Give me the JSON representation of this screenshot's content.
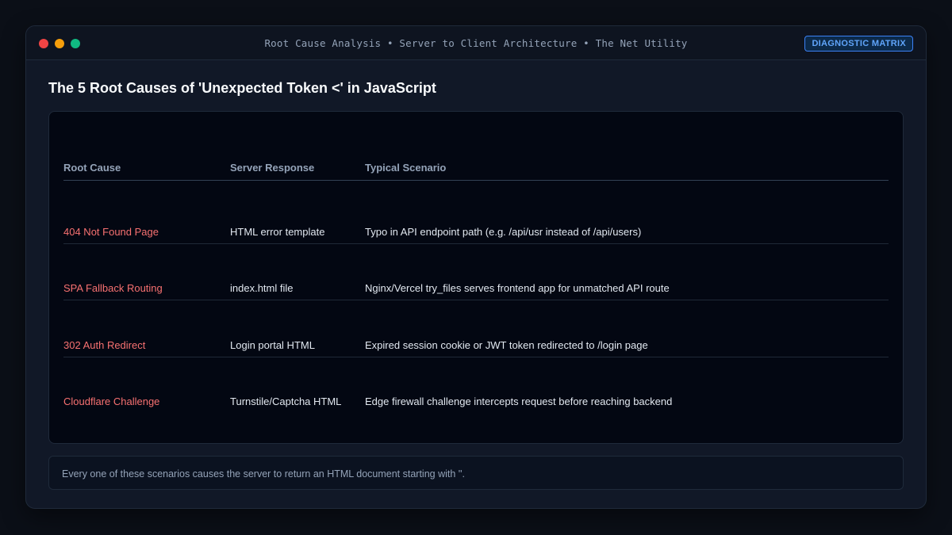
{
  "window": {
    "title": "Root Cause Analysis • Server to Client Architecture • The Net Utility",
    "badge": "DIAGNOSTIC MATRIX"
  },
  "heading": "The 5 Root Causes of 'Unexpected Token <' in JavaScript",
  "table": {
    "columns": [
      "Root Cause",
      "Server Response",
      "Typical Scenario"
    ],
    "rows": [
      {
        "cause": "404 Not Found Page",
        "response": "HTML error template",
        "scenario": "Typo in API endpoint path (e.g. /api/usr instead of /api/users)"
      },
      {
        "cause": "SPA Fallback Routing",
        "response": "index.html file",
        "scenario": "Nginx/Vercel try_files serves frontend app for unmatched API route"
      },
      {
        "cause": "302 Auth Redirect",
        "response": "Login portal HTML",
        "scenario": "Expired session cookie or JWT token redirected to /login page"
      },
      {
        "cause": "Cloudflare Challenge",
        "response": "Turnstile/Captcha HTML",
        "scenario": "Edge firewall challenge intercepts request before reaching backend"
      }
    ]
  },
  "footer": {
    "note": "Every one of these scenarios causes the server to return an HTML document starting with ''."
  },
  "colors": {
    "background": "#0b0f17",
    "accent": "#60a5fa",
    "cause_text": "#f87171",
    "traffic_red": "#ef4444",
    "traffic_yellow": "#f59e0b",
    "traffic_green": "#10b981"
  }
}
